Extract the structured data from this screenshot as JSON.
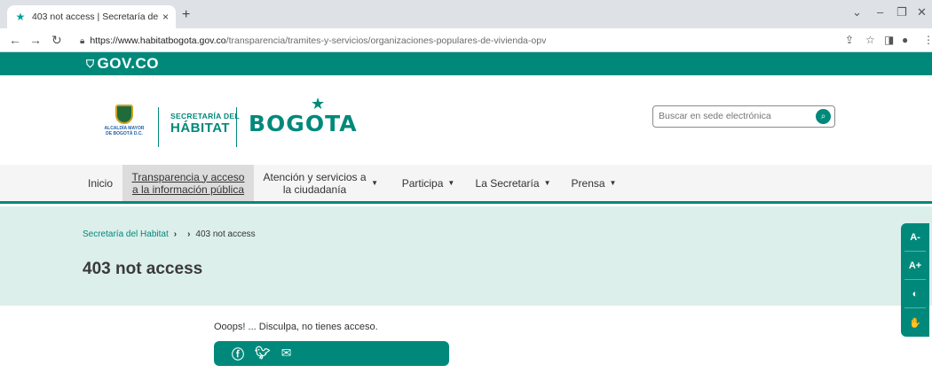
{
  "browser": {
    "tab_title": "403 not access | Secretaría del Há",
    "tab_close": "×",
    "new_tab": "+",
    "url_domain": "https://www.habitatbogota.gov.co",
    "url_path": "/transparencia/tramites-y-servicios/organizaciones-populares-de-vivienda-opv"
  },
  "gov": {
    "label": "GOV.CO"
  },
  "header": {
    "crest_text": "ALCALDÍA MAYOR DE BOGOTÁ D.C.",
    "secretaria_line1": "SECRETARÍA DEL",
    "secretaria_line2": "HÁBITAT",
    "bogota": "BOGOTA",
    "search_placeholder": "Buscar en sede electrónica"
  },
  "nav": {
    "items": [
      {
        "label": "Inicio"
      },
      {
        "label": "Transparencia y acceso a la información pública"
      },
      {
        "label": "Atención y servicios a la ciudadanía"
      },
      {
        "label": "Participa"
      },
      {
        "label": "La Secretaría"
      },
      {
        "label": "Prensa"
      }
    ]
  },
  "breadcrumb": {
    "home": "Secretaría del Habitat",
    "current": "403 not access"
  },
  "page": {
    "title": "403 not access",
    "message": "Ooops! ... Disculpa, no tienes acceso."
  },
  "accessibility": {
    "decrease": "A-",
    "increase": "A+"
  },
  "colors": {
    "brand": "#00897b",
    "hero_bg": "#dcefeb"
  }
}
